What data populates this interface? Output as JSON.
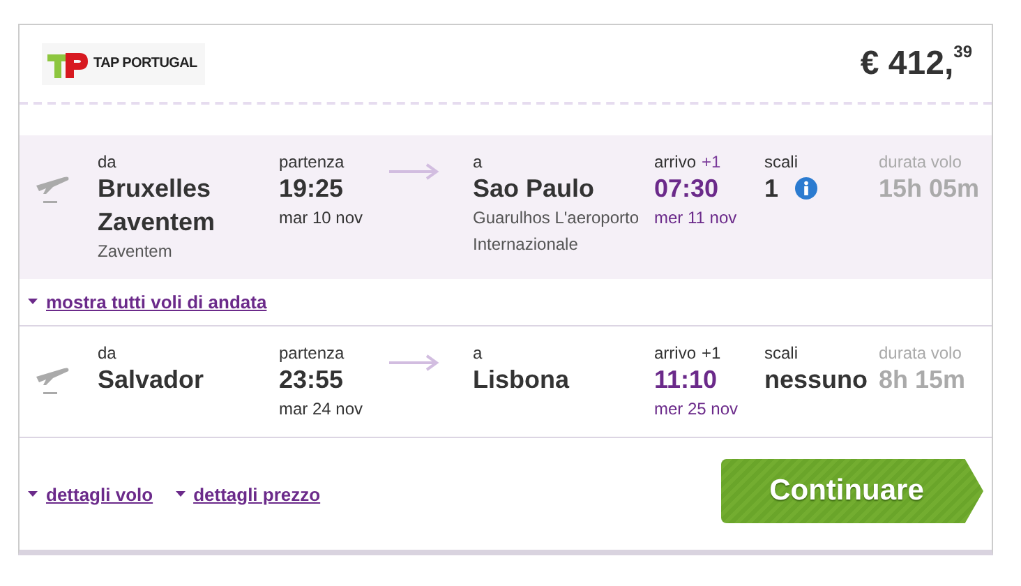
{
  "airline": {
    "name": "TAP PORTUGAL"
  },
  "price": "€ 412,$^{39}$",
  "segments": [
    {
      "highlighted": true,
      "from_label": "da",
      "from_city": "Bruxelles Zaventem",
      "from_airport": "Zaventem",
      "dep_label": "partenza",
      "dep_time": "19:25",
      "dep_date": "mar 10 nov",
      "to_label": "a",
      "to_city": "Sao Paulo",
      "to_airport": "Guarulhos L'aeroporto Internazionale",
      "arr_label": "arrivo",
      "arr_offset": "+1",
      "arr_time": "07:30",
      "arr_date": "mer 11 nov",
      "stops_label": "scali",
      "stops": "1",
      "info": true,
      "duration_label": "durata volo",
      "duration": "15h 05m"
    },
    {
      "highlighted": false,
      "from_label": "da",
      "from_city": "Salvador",
      "dep_label": "partenza",
      "dep_time": "23:55",
      "dep_date": "mar 24 nov",
      "to_label": "a",
      "to_city": "Lisbona",
      "arr_label": "arrivo",
      "arr_offset": "+1",
      "arr_time": "11:10",
      "arr_date": "mer 25 nov",
      "stops_label": "scali",
      "stops": "nessuno",
      "info": false,
      "duration_label": "durata volo",
      "duration": "8h 15m"
    }
  ],
  "show_all_link": "mostra tutti voli di andata",
  "footer_links": [
    "dettagli volo",
    "dettagli prezzo"
  ],
  "continue_button": "Continuare"
}
